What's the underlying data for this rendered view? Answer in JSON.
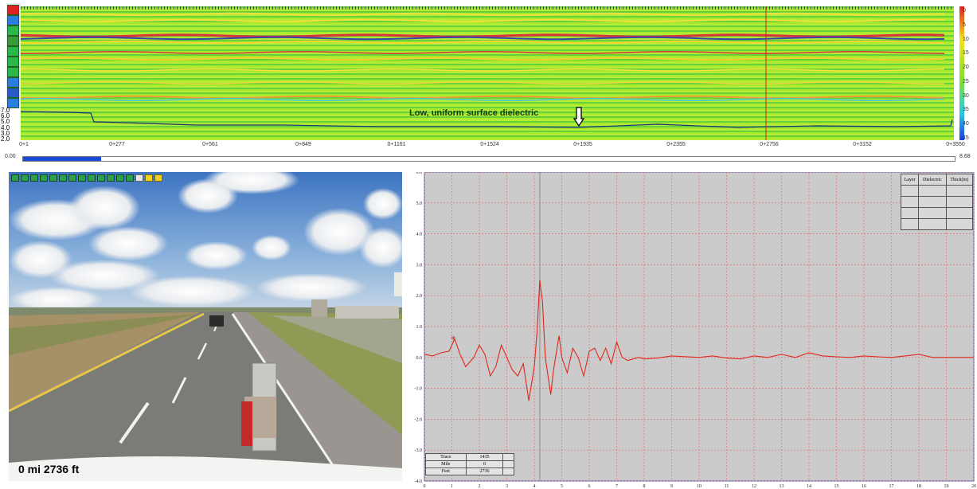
{
  "radargram": {
    "annotation": "Low, uniform surface dielectric",
    "toolbar_icons": [
      "profile-icon",
      "flag-icon",
      "arrow-icon",
      "zoom-icon",
      "grid-icon",
      "h-icon",
      "z-icon",
      "play-icon",
      "marker-icon",
      "filter-icon"
    ],
    "left_scale_labels": [
      "7.0",
      "6.0",
      "5.0",
      "4.0",
      "3.0",
      "2.0"
    ],
    "depth_ticks": [
      "0",
      "5",
      "10",
      "15",
      "20",
      "25",
      "30",
      "35",
      "40",
      "45"
    ],
    "distance_labels": [
      "0+1",
      "0+277",
      "0+561",
      "0+849",
      "0+1161",
      "0+1524",
      "0+1935",
      "0+2355",
      "0+2756",
      "0+3152",
      "0+3550"
    ],
    "progress": {
      "min_label": "0.00",
      "max_label": "8.68",
      "fraction": 0.084
    },
    "colors": {
      "background": "#7ee12a",
      "reflection_red": "#d8343a",
      "reflection_blue": "#3646a8",
      "cursor": "#cc2222",
      "dielectric_line": "#1c2f7a"
    }
  },
  "camera": {
    "caption": "0 mi 2736 ft",
    "toolbar_buttons": 16
  },
  "waveform": {
    "y_ticks": [
      "6.0",
      "5.0",
      "4.0",
      "3.0",
      "2.0",
      "1.0",
      "0.0",
      "-1.0",
      "-2.0",
      "-3.0",
      "-4.0"
    ],
    "x_ticks": [
      "0",
      "1",
      "2",
      "3",
      "4",
      "5",
      "6",
      "7",
      "8",
      "9",
      "10",
      "11",
      "12",
      "13",
      "14",
      "15",
      "16",
      "17",
      "18",
      "19",
      "20"
    ],
    "marker_symbol": "*",
    "layer_table": {
      "headers": [
        "Layer",
        "Dielectric",
        "Thick(in)"
      ],
      "rows": 4
    },
    "trace_table": {
      "rows": [
        {
          "label": "Trace",
          "value": "1435"
        },
        {
          "label": "Mile",
          "value": "0"
        },
        {
          "label": "Feet",
          "value": "2736"
        }
      ]
    },
    "colors": {
      "background": "#cbcbcb",
      "trace": "#e0281e",
      "grid": "#e27070",
      "cursor": "#8a8a8a"
    }
  },
  "chart_data": {
    "type": "line",
    "title": "",
    "xlabel": "",
    "ylabel": "",
    "xlim": [
      0,
      20
    ],
    "ylim": [
      -4,
      6
    ],
    "grid": true,
    "series": [
      {
        "x": [
          0,
          0.3,
          0.6,
          0.9,
          1.1,
          1.3,
          1.5,
          1.8,
          2.0,
          2.2,
          2.4,
          2.6,
          2.8,
          3.0,
          3.2,
          3.4,
          3.6,
          3.8,
          4.0,
          4.1,
          4.2,
          4.3,
          4.4,
          4.6,
          4.7,
          4.9,
          5.0,
          5.2,
          5.4,
          5.6,
          5.8,
          6.0,
          6.2,
          6.4,
          6.6,
          6.8,
          7.0,
          7.2,
          7.4,
          7.6,
          7.8,
          8.0,
          8.5,
          9.0,
          10,
          10.5,
          11,
          11.5,
          12,
          12.5,
          13,
          13.5,
          14,
          14.5,
          15,
          15.5,
          16,
          16.5,
          17,
          17.5,
          18,
          18.5,
          19,
          20
        ],
        "y": [
          0.1,
          0.05,
          0.15,
          0.2,
          0.6,
          0.1,
          -0.3,
          0.0,
          0.4,
          0.1,
          -0.6,
          -0.3,
          0.4,
          0.0,
          -0.4,
          -0.6,
          -0.2,
          -1.4,
          -0.3,
          0.8,
          2.5,
          1.8,
          0.0,
          -1.2,
          -0.4,
          0.7,
          0.0,
          -0.5,
          0.3,
          0.0,
          -0.6,
          0.2,
          0.3,
          -0.1,
          0.3,
          -0.2,
          0.5,
          0.0,
          -0.1,
          -0.05,
          0.0,
          -0.05,
          -0.02,
          0.05,
          0.0,
          0.05,
          -0.02,
          -0.05,
          0.05,
          0.0,
          0.1,
          0.0,
          0.15,
          0.05,
          0.02,
          0.0,
          0.05,
          0.02,
          0.0,
          0.05,
          0.1,
          0.0,
          0.0,
          0.0
        ]
      }
    ],
    "marker": {
      "x": 1.05,
      "y": 0.55
    }
  }
}
